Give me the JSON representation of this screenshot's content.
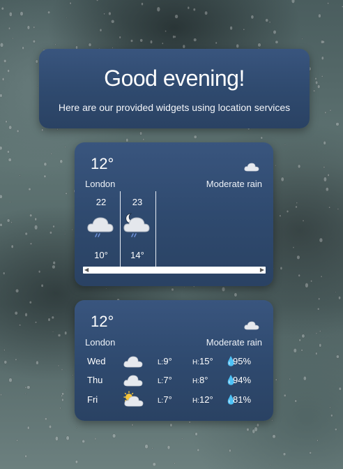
{
  "greeting": {
    "title": "Good evening!",
    "subtitle": "Here are our provided widgets using location services"
  },
  "hourly_widget": {
    "temperature": "12°",
    "city": "London",
    "condition": "Moderate rain",
    "condition_icon": "cloud-icon",
    "hours": [
      {
        "hour": "22",
        "icon": "rain-cloud-icon",
        "temp": "10°"
      },
      {
        "hour": "23",
        "icon": "night-rain-cloud-icon",
        "temp": "14°"
      }
    ]
  },
  "daily_widget": {
    "temperature": "12°",
    "city": "London",
    "condition": "Moderate rain",
    "condition_icon": "cloud-icon",
    "low_label": "L:",
    "high_label": "H:",
    "days": [
      {
        "day": "Wed",
        "icon": "cloud-icon",
        "low": "9°",
        "high": "15°",
        "humidity": "95%"
      },
      {
        "day": "Thu",
        "icon": "cloud-icon",
        "low": "7°",
        "high": "8°",
        "humidity": "94%"
      },
      {
        "day": "Fri",
        "icon": "sun-cloud-icon",
        "low": "7°",
        "high": "12°",
        "humidity": "81%"
      }
    ]
  }
}
